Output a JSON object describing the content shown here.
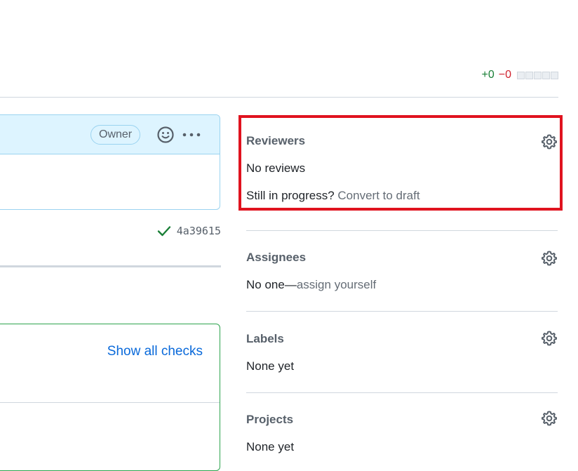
{
  "diffstat": {
    "additions": "+0",
    "deletions": "−0"
  },
  "comment": {
    "author_badge": "Owner"
  },
  "commit": {
    "sha": "4a39615",
    "status_color": "#1a7f37"
  },
  "checks": {
    "show_all": "Show all checks"
  },
  "sidebar": {
    "reviewers": {
      "title": "Reviewers",
      "value": "No reviews",
      "prompt": "Still in progress?",
      "action": "Convert to draft"
    },
    "assignees": {
      "title": "Assignees",
      "value": "No one—",
      "action": "assign yourself"
    },
    "labels": {
      "title": "Labels",
      "value": "None yet"
    },
    "projects": {
      "title": "Projects",
      "value": "None yet"
    }
  },
  "colors": {
    "highlight": "#e0131f",
    "link": "#0969da",
    "add": "#1a7f37",
    "delete": "#cf222e"
  }
}
